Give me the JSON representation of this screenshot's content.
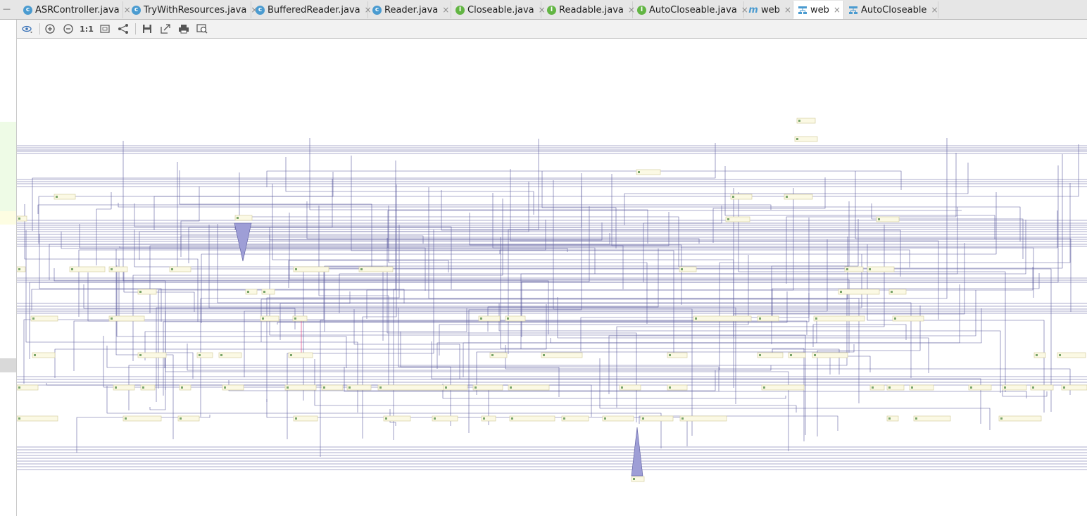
{
  "window": {
    "menu_glyph": "—"
  },
  "tabs": [
    {
      "label": "ASRController.java",
      "icon": "class-icon",
      "glyph": "c",
      "kind": "c",
      "active": false
    },
    {
      "label": "TryWithResources.java",
      "icon": "class-icon",
      "glyph": "c",
      "kind": "c",
      "active": false
    },
    {
      "label": "BufferedReader.java",
      "icon": "class-icon",
      "glyph": "c",
      "kind": "c",
      "active": false
    },
    {
      "label": "Reader.java",
      "icon": "abstract-class-icon",
      "glyph": "c",
      "kind": "c",
      "active": false
    },
    {
      "label": "Closeable.java",
      "icon": "interface-icon",
      "glyph": "I",
      "kind": "i",
      "active": false
    },
    {
      "label": "Readable.java",
      "icon": "interface-icon",
      "glyph": "I",
      "kind": "i",
      "active": false
    },
    {
      "label": "AutoCloseable.java",
      "icon": "interface-icon",
      "glyph": "I",
      "kind": "i",
      "active": false
    },
    {
      "label": "web",
      "icon": "maven-icon",
      "glyph": "m",
      "kind": "m",
      "active": false
    },
    {
      "label": "web",
      "icon": "uml-diagram-icon",
      "glyph": "",
      "kind": "uml",
      "active": true
    },
    {
      "label": "AutoCloseable",
      "icon": "uml-diagram-icon",
      "glyph": "",
      "kind": "uml",
      "active": false
    }
  ],
  "tab_close_glyph": "×",
  "toolbar": {
    "view_options": "view-options-icon",
    "zoom_in": "zoom-in-icon",
    "zoom_out": "zoom-out-icon",
    "actual_size_label": "1:1",
    "fit_content": "fit-content-icon",
    "layout": "apply-layout-icon",
    "save": "save-diagram-icon",
    "export": "export-icon",
    "print": "print-icon",
    "magnifier": "magnifier-icon"
  },
  "diagram": {
    "type": "maven-dependency-graph",
    "colors": {
      "edge": "#5c5c9e",
      "node_fill": "#fbf9e4",
      "node_border": "#d4cfa0",
      "highlight_edge": "#e0206a",
      "fan_fill": "#9e9ed6"
    }
  }
}
